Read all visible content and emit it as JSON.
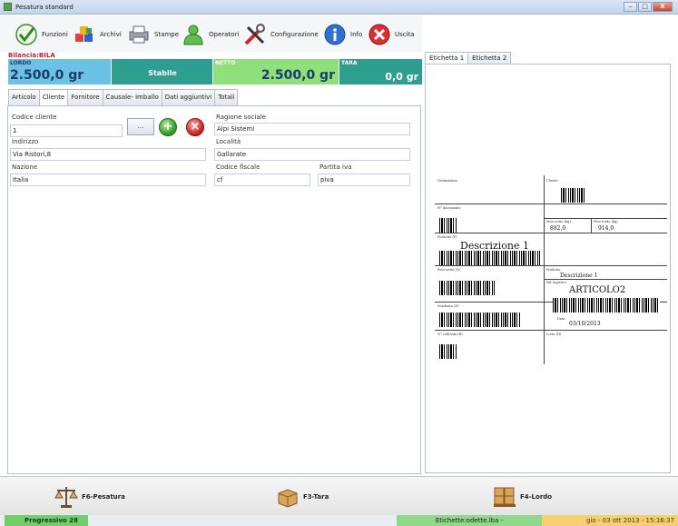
{
  "window": {
    "title": "Pesatura standard",
    "minimize": "‒",
    "maximize": "□",
    "close": "X"
  },
  "toolbar": [
    {
      "label": "Funzioni",
      "icon": "checkmark-icon"
    },
    {
      "label": "Archivi",
      "icon": "archive-icon"
    },
    {
      "label": "Stampe",
      "icon": "printer-icon"
    },
    {
      "label": "Operatori",
      "icon": "user-icon"
    },
    {
      "label": "Configurazione",
      "icon": "tools-icon"
    },
    {
      "label": "Info",
      "icon": "info-icon"
    },
    {
      "label": "Uscita",
      "icon": "exit-icon"
    }
  ],
  "bilancia": "Bilancia:BILA",
  "weights": {
    "lordo_label": "LORDO",
    "lordo_value": "2.500,0 gr",
    "stato": "Stabile",
    "netto_label": "NETTO",
    "netto_value": "2.500,0 gr",
    "tara_label": "TARA",
    "tara_value": "0,0 gr"
  },
  "tabs": [
    "Articolo",
    "Cliente",
    "Fornitore",
    "Causale- imballo",
    "Dati aggiuntivi",
    "Totali"
  ],
  "active_tab": "Cliente",
  "cliente": {
    "codice_label": "Codice cliente",
    "codice_value": "1",
    "browse_label": "...",
    "ragione_label": "Ragione sociale",
    "ragione_value": "Alpi Sistemi",
    "indirizzo_label": "Indirizzo",
    "indirizzo_value": "Via Ristori,8",
    "localita_label": "Località",
    "localita_value": "Gallarate",
    "nazione_label": "Nazione",
    "nazione_value": "Italia",
    "cf_label": "Codice fiscale",
    "cf_value": "cf",
    "piva_label": "Partita iva",
    "piva_value": "piva"
  },
  "right_tabs": [
    "Etichetta 1",
    "Etichetta 2"
  ],
  "label_preview": {
    "destinatario": "Destinatario",
    "cliente": "Cliente",
    "n_documento": "N° documento",
    "peso_netto": "Peso netto (kg)",
    "peso_lordo": "Peso lordo (kg)",
    "peso_netto_val": "882,0",
    "peso_lordo_val": "914,0",
    "prodotto": "Prodotto (F)",
    "descrizione": "Descrizione 1",
    "peso_netto_2": "Peso netto (Q)",
    "prodotto_2": "Prodotto",
    "descrizione_2": "Descrizione 1",
    "rif_logistico": "Rif. logistico",
    "articolo": "ARTICOLO2",
    "scadenza": "Scadenza (D)",
    "data_label": "Data",
    "data": "03/10/2013",
    "n_colli": "N° colli/vita (R)",
    "lotto": "Lotto (H)"
  },
  "function_keys": [
    {
      "label": "F6-Pesatura",
      "icon": "scale-icon"
    },
    {
      "label": "F3-Tara",
      "icon": "box-icon"
    },
    {
      "label": "F4-Lordo",
      "icon": "pallet-icon"
    }
  ],
  "status": {
    "progressivo": "Progressivo 28",
    "etichette": "Etichette:odette.lba -",
    "data_ora": "gio - 03 ott 2013 - 15:16:37"
  }
}
